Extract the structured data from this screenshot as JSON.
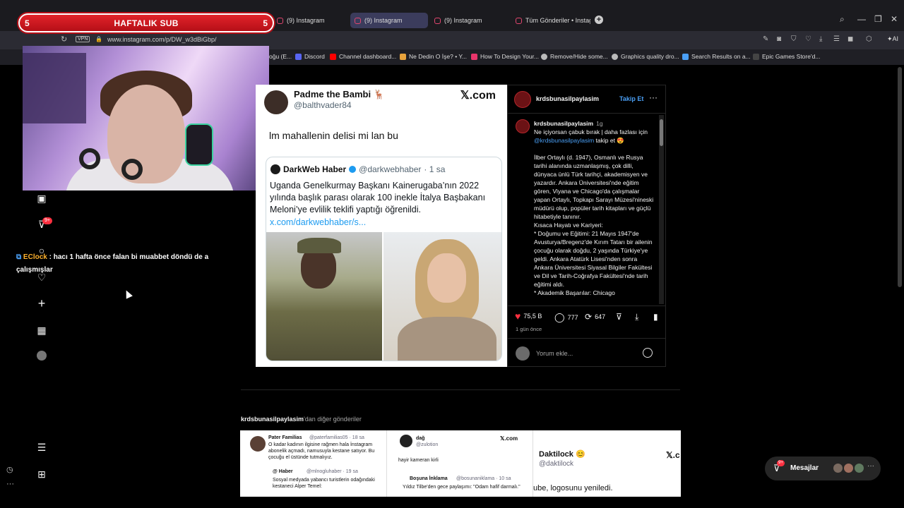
{
  "overlay": {
    "sub_label": "HAFTALIK SUB",
    "sub_left": "5",
    "sub_right": "5",
    "chat_user": "EClock",
    "chat_message": ": hacı 1 hafta önce falan bi muabbet döndü de a çalışmışlar"
  },
  "browser": {
    "tabs": [
      {
        "label": "(9) Instagram"
      },
      {
        "label": "(9) Instagram"
      },
      {
        "label": "(9) Instagram"
      },
      {
        "label": "Tüm Gönderiler • Instagram"
      }
    ],
    "vpn": "VPN",
    "url": "www.instagram.com/p/DW_w3dBiGbp/",
    "ai_label": "AI",
    "bookmarks": [
      {
        "label": "oğu (E...",
        "color": "#888888"
      },
      {
        "label": "Discord",
        "color": "#5865f2"
      },
      {
        "label": "Channel dashboard...",
        "color": "#ff0000"
      },
      {
        "label": "Ne Dedin O İşe? • Y...",
        "color": "#e8a33c"
      },
      {
        "label": "How To Design Your...",
        "color": "#e8356b"
      },
      {
        "label": "Remove/Hide some...",
        "color": "#bbbbbb"
      },
      {
        "label": "Graphics quality dro...",
        "color": "#bbbbbb"
      },
      {
        "label": "Search Results on a...",
        "color": "#4a9ff5"
      },
      {
        "label": "Epic Games Store'd...",
        "color": "#333333"
      }
    ]
  },
  "sidebar": {
    "badge": "9+"
  },
  "post_image": {
    "name": "Padme the Bambi 🦌",
    "handle": "@balthvader84",
    "brand": "𝕏.com",
    "text": "lm mahallenin delisi mi lan bu",
    "quote": {
      "name": "DarkWeb Haber",
      "handle": "@darkwebhaber",
      "time": "· 1 sa",
      "text": "Uganda Genelkurmay Başkanı Kainerugaba’nın 2022 yılında başlık parası olarak 100 inekle İtalya Başbakanı Meloni’ye evlilik teklifi yaptığı öğrenildi.",
      "link": "x.com/darkwebhaber/s..."
    }
  },
  "panel": {
    "username": "krdsbunasilpaylasim",
    "follow": "Takip Et",
    "more": "···",
    "caption_user": "krdsbunasilpaylasim",
    "caption_time": "1g",
    "caption_intro": "Ne içiyorsan çabuk bırak | daha fazlası için",
    "caption_mention": "@krdsbunasilpaylasim",
    "caption_intro_end": "takip et 😍",
    "caption_body1": "İlber Ortaylı (d. 1947), Osmanlı ve Rusya tarihi alanında uzmanlaşmış, çok dilli, dünyaca ünlü Türk tarihçi, akademisyen ve yazardır. Ankara Üniversitesi'nde eğitim gören, Viyana ve Chicago'da çalışmalar yapan Ortaylı, Topkapı Sarayı Müzesi'nineski müdürü olup, popüler tarih kitapları ve güçlü hitabetiyle tanınır.",
    "caption_body2": "Kısaca Hayatı ve Kariyeri:",
    "caption_body3": "* Doğumu ve Eğitimi: 21 Mayıs 1947'de Avusturya/Bregenz'de Kırım Tatarı bir ailenin çocuğu olarak doğdu, 2 yaşında Türkiye'ye geldi. Ankara Atatürk Lisesi'nden sonra Ankara Üniversitesi Siyasal Bilgiler Fakültesi ve Dil ve Tarih-Coğrafya Fakültesi'nde tarih eğitimi aldı.",
    "caption_body4": "* Akademik Başarılar: Chicago",
    "likes": "75,5 B",
    "comments": "777",
    "reposts": "647",
    "ago": "1 gün önce",
    "comment_placeholder": "Yorum ekle..."
  },
  "more_posts": {
    "title_user": "krdsbunasilpaylasim",
    "title_rest": "'dan diğer gönderiler",
    "t1_name": "Pater Familias",
    "t1_handle": "@paterfamilias05 · 18 sa",
    "t1_text": "O kadar kadının ilgisine rağmen hala İnstagram abonelik açmadı, namusuyla kestane satıyor. Bu çocuğu el üstünde tutmalıyız.",
    "t1_q_name": "@ Haber",
    "t1_q_handle": "@mlnogluhaber · 19 sa",
    "t1_q_text": "Sosyal medyada yabancı turistlerin odağındaki kestaneci Alper Temel:",
    "t2_name": "dağ",
    "t2_handle": "@zulotion",
    "t2_brand": "𝕏.com",
    "t2_text": "hayir kameran kirli",
    "t2_q_name": "Boşuna İnklama",
    "t2_q_handle": "@bosunaniklama · 10 sa",
    "t2_q_text": "Yıldız Tilbe'den gece paylaşımı: \"Odam hafif darmalı.\"",
    "t3_name": "Daktilock 😊",
    "t3_handle": "@daktilock",
    "t3_brand": "𝕏.c",
    "t3_text": "ube, logosunu yeniledi."
  },
  "messages": {
    "label": "Mesajlar",
    "badge": "9+",
    "more": "···"
  }
}
